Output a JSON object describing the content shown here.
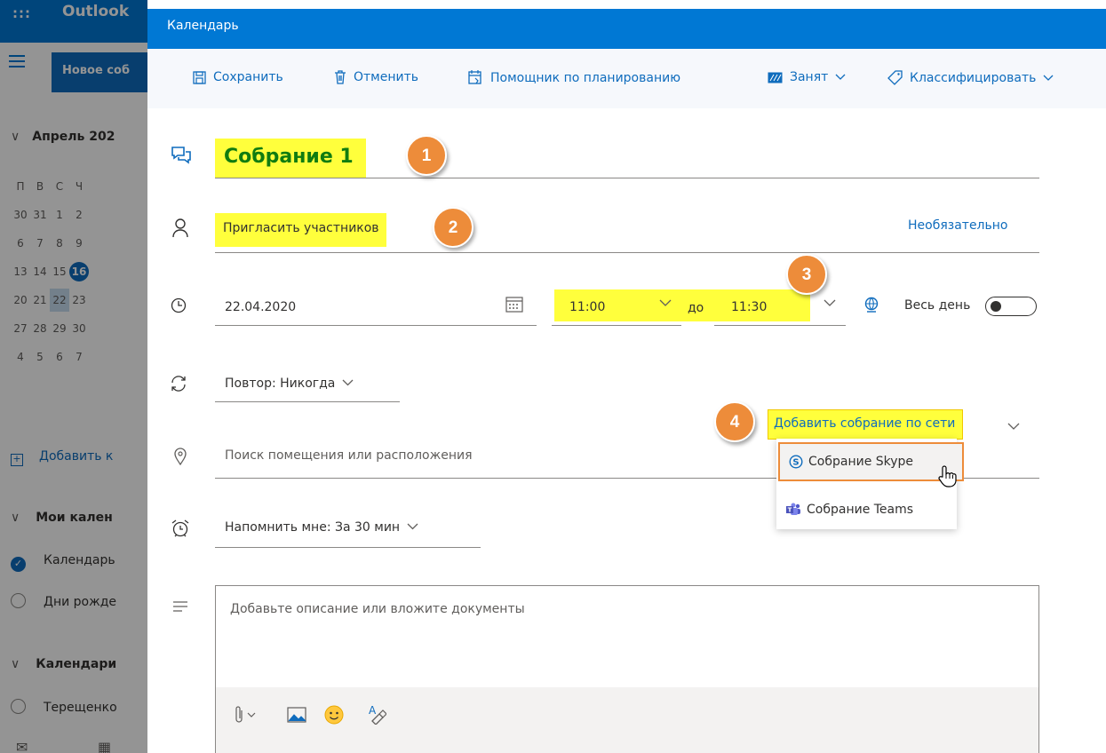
{
  "background_app": {
    "brand": "Outlook",
    "new_button": "Новое соб",
    "month_title": "Апрель 202",
    "weekdays": [
      "П",
      "В",
      "С",
      "Ч"
    ],
    "weeks": [
      [
        "30",
        "31",
        "1",
        "2"
      ],
      [
        "6",
        "7",
        "8",
        "9"
      ],
      [
        "13",
        "14",
        "15",
        "16"
      ],
      [
        "20",
        "21",
        "22",
        "23"
      ],
      [
        "27",
        "28",
        "29",
        "30"
      ],
      [
        "4",
        "5",
        "6",
        "7"
      ]
    ],
    "add_calendar": "Добавить к",
    "my_calendars": "Мои кален",
    "calendar_item": "Календарь",
    "birthdays_item": "Дни рожде",
    "calendars_section": "Календари",
    "person_item": "Терещенко"
  },
  "panel": {
    "title": "Календарь"
  },
  "toolbar": {
    "save": "Сохранить",
    "cancel": "Отменить",
    "scheduling": "Помощник по планированию",
    "busy": "Занят",
    "classify": "Классифицировать"
  },
  "form": {
    "title": "Собрание 1",
    "invite": "Пригласить участников",
    "optional": "Необязательно",
    "date": "22.04.2020",
    "start_time": "11:00",
    "to_label": "до",
    "end_time": "11:30",
    "all_day": "Весь день",
    "all_day_on": false,
    "repeat": "Повтор: Никогда",
    "online_meeting": "Добавить собрание по сети",
    "online_options": [
      "Собрание Skype",
      "Собрание Teams"
    ],
    "location_placeholder": "Поиск помещения или расположения",
    "reminder": "Напомнить мне: За 30 мин",
    "description_placeholder": "Добавьте описание или вложите документы"
  },
  "badges": [
    "1",
    "2",
    "3",
    "4"
  ],
  "colors": {
    "accent": "#0078d4",
    "link": "#0f6cbd",
    "highlight": "#ffff3c",
    "badge": "#ed8c3a",
    "title_green": "#107c10"
  }
}
